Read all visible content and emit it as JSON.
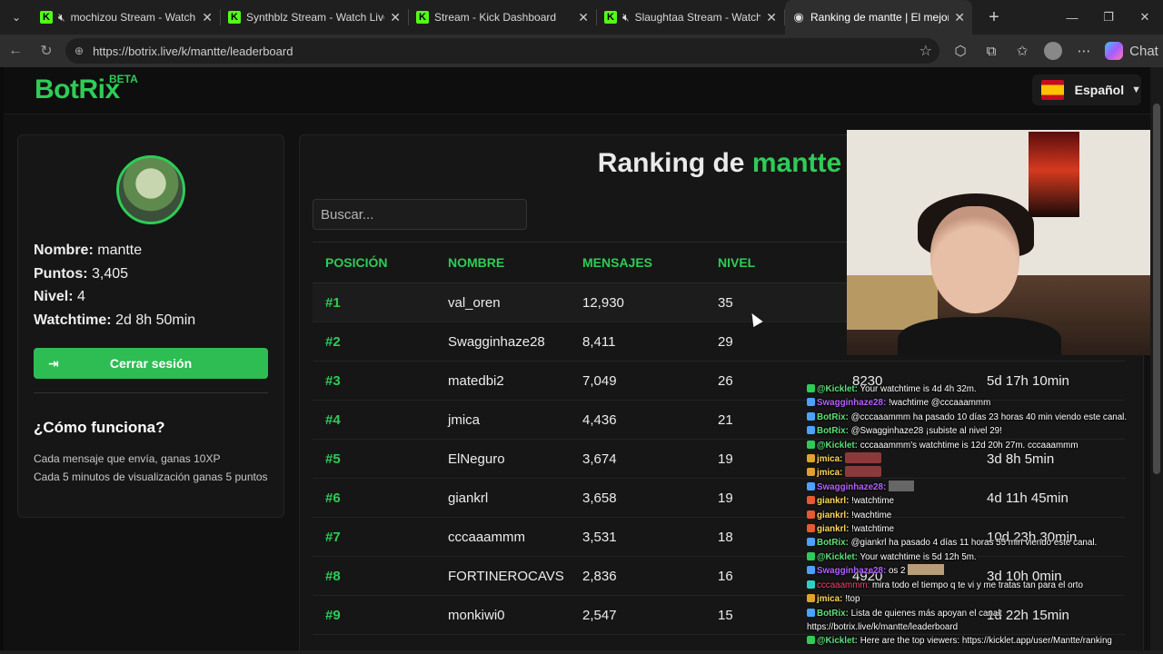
{
  "browser": {
    "tabs": [
      {
        "title": "mochizou Stream - Watch",
        "muted": true,
        "icon": "kick-icon"
      },
      {
        "title": "Synthblz Stream - Watch Live o",
        "muted": false,
        "icon": "kick-icon"
      },
      {
        "title": "Stream - Kick Dashboard",
        "muted": false,
        "icon": "kick-icon"
      },
      {
        "title": "Slaughtaa Stream - Watch",
        "muted": true,
        "icon": "kick-icon"
      },
      {
        "title": "Ranking de mantte | El mejor s",
        "muted": false,
        "icon": "botrix-icon"
      }
    ],
    "url": "https://botrix.live/k/mantte/leaderboard",
    "chat_label": "Chat"
  },
  "header": {
    "logo": "BotRix",
    "beta": "BETA",
    "language": "Español"
  },
  "profile": {
    "name_label": "Nombre:",
    "name": "mantte",
    "points_label": "Puntos:",
    "points": "3,405",
    "level_label": "Nivel:",
    "level": "4",
    "watchtime_label": "Watchtime:",
    "watchtime": "2d 8h 50min",
    "logout": "Cerrar sesión",
    "how_title": "¿Cómo funciona?",
    "how_line1": "Cada mensaje que envía, ganas 10XP",
    "how_line2": "Cada 5 minutos de visualización ganas 5 puntos"
  },
  "ranking": {
    "title_prefix": "Ranking de",
    "title_name": "mantte",
    "search_placeholder": "Buscar...",
    "columns": [
      "POSICIÓN",
      "NOMBRE",
      "MENSAJES",
      "NIVEL"
    ],
    "rows": [
      {
        "pos": "#1",
        "name": "val_oren",
        "messages": "12,930",
        "level": "35",
        "points": "",
        "watchtime": ""
      },
      {
        "pos": "#2",
        "name": "Swagginhaze28",
        "messages": "8,411",
        "level": "29",
        "points": "",
        "watchtime": ""
      },
      {
        "pos": "#3",
        "name": "matedbi2",
        "messages": "7,049",
        "level": "26",
        "points": "8230",
        "watchtime": "5d 17h 10min"
      },
      {
        "pos": "#4",
        "name": "jmica",
        "messages": "4,436",
        "level": "21",
        "points": "",
        "watchtime": ""
      },
      {
        "pos": "#5",
        "name": "ElNeguro",
        "messages": "3,674",
        "level": "19",
        "points": "",
        "watchtime": "3d 8h 5min"
      },
      {
        "pos": "#6",
        "name": "giankrl",
        "messages": "3,658",
        "level": "19",
        "points": "",
        "watchtime": "4d 11h 45min"
      },
      {
        "pos": "#7",
        "name": "cccaaammm",
        "messages": "3,531",
        "level": "18",
        "points": "",
        "watchtime": "10d 23h 30min"
      },
      {
        "pos": "#8",
        "name": "FORTINEROCAVS",
        "messages": "2,836",
        "level": "16",
        "points": "4920",
        "watchtime": "3d 10h 0min"
      },
      {
        "pos": "#9",
        "name": "monkiwi0",
        "messages": "2,547",
        "level": "15",
        "points": "",
        "watchtime": "1d 22h 15min"
      }
    ]
  },
  "chat_overlay": [
    {
      "user": "@Kicklet:",
      "cls": "u1",
      "badge": "b-green",
      "text": "Your watchtime is 4d 4h 32m."
    },
    {
      "user": "Swagginhaze28:",
      "cls": "u2",
      "badge": "b-blue",
      "text": "!wachtime @cccaaammm"
    },
    {
      "user": "BotRix:",
      "cls": "u1",
      "badge": "b-blue",
      "text": "@cccaaammm ha pasado 10 días 23 horas 40 min viendo este canal."
    },
    {
      "user": "BotRix:",
      "cls": "u1",
      "badge": "b-blue",
      "text": "@Swagginhaze28 ¡subiste al nivel 29!"
    },
    {
      "user": "@Kicklet:",
      "cls": "u1",
      "badge": "b-green",
      "text": "cccaaammm's watchtime is 12d 20h 27m. cccaaammm"
    },
    {
      "user": "jmica:",
      "cls": "u3",
      "badge": "b-gold",
      "text": "",
      "emote": "emote"
    },
    {
      "user": "jmica:",
      "cls": "u3",
      "badge": "b-gold",
      "text": "",
      "emote": "emote"
    },
    {
      "user": "Swagginhaze28:",
      "cls": "u2",
      "badge": "b-blue",
      "text": "",
      "emote": "emote2"
    },
    {
      "user": "giankrl:",
      "cls": "u3",
      "badge": "b-red",
      "text": "!watchtime"
    },
    {
      "user": "giankrl:",
      "cls": "u3",
      "badge": "b-red",
      "text": "!wachtime"
    },
    {
      "user": "giankrl:",
      "cls": "u3",
      "badge": "b-red",
      "text": "!watchtime"
    },
    {
      "user": "BotRix:",
      "cls": "u1",
      "badge": "b-blue",
      "text": "@giankrl ha pasado 4 días 11 horas 55 min viendo este canal."
    },
    {
      "user": "@Kicklet:",
      "cls": "u1",
      "badge": "b-green",
      "text": "Your watchtime is 5d 12h 5m."
    },
    {
      "user": "Swagginhaze28:",
      "cls": "u2",
      "badge": "b-blue",
      "text": "os 2",
      "emote": "emote3"
    },
    {
      "user": "cccaaammm:",
      "cls": "u4",
      "badge": "b-cyan",
      "text": "mira todo el tiempo q te vi y me tratas tan para el orto"
    },
    {
      "user": "jmica:",
      "cls": "u3",
      "badge": "b-gold",
      "text": "!top"
    },
    {
      "user": "BotRix:",
      "cls": "u1",
      "badge": "b-blue",
      "text": "Lista de quienes más apoyan el canal:"
    },
    {
      "user": "",
      "cls": "",
      "badge": "",
      "text": "https://botrix.live/k/mantte/leaderboard"
    },
    {
      "user": "@Kicklet:",
      "cls": "u1",
      "badge": "b-green",
      "text": "Here are the top viewers: https://kicklet.app/user/Mantte/ranking"
    }
  ]
}
